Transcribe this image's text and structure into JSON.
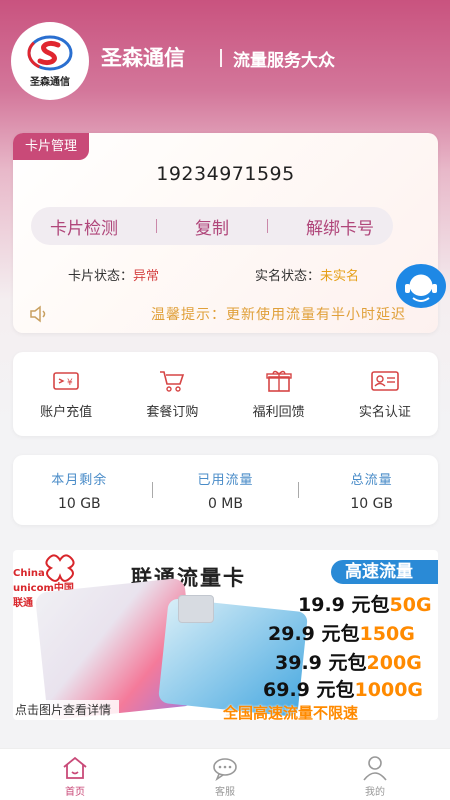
{
  "header": {
    "logo_text": "圣森通信",
    "brand": "圣森通信",
    "slogan": "流量服务大众"
  },
  "card": {
    "tag": "卡片管理",
    "number": "19234971595",
    "actions": [
      "卡片检测",
      "复制",
      "解绑卡号"
    ],
    "card_status_label": "卡片状态：",
    "card_status_value": "异常",
    "realname_label": "实名状态：",
    "realname_value": "未实名",
    "tip": "温馨提示：更新使用流量有半小时延迟"
  },
  "menu": {
    "items": [
      {
        "label": "账户充值",
        "icon": "recharge-icon"
      },
      {
        "label": "套餐订购",
        "icon": "cart-icon"
      },
      {
        "label": "福利回馈",
        "icon": "gift-icon"
      },
      {
        "label": "实名认证",
        "icon": "id-card-icon"
      }
    ]
  },
  "stats": {
    "remaining_label": "本月剩余",
    "remaining_value": "10 GB",
    "used_label": "已用流量",
    "used_value": "0 MB",
    "total_label": "总流量",
    "total_value": "10 GB"
  },
  "banner": {
    "brand_text": "China unicom中国联通",
    "title": "联通流量卡",
    "badge": "高速流量",
    "prices": [
      {
        "price": "19.9",
        "unit": "元包",
        "package": "50G"
      },
      {
        "price": "29.9",
        "unit": "元包",
        "package": "150G"
      },
      {
        "price": "39.9",
        "unit": "元包",
        "package": "200G"
      },
      {
        "price": "69.9",
        "unit": "元包",
        "package": "1000G"
      }
    ],
    "slogan": "全国高速流量不限速",
    "detail": "点击图片查看详情"
  },
  "tabbar": {
    "items": [
      {
        "label": "首页",
        "icon": "home-icon",
        "active": true
      },
      {
        "label": "客服",
        "icon": "chat-icon",
        "active": false
      },
      {
        "label": "我的",
        "icon": "user-icon",
        "active": false
      }
    ]
  },
  "colors": {
    "primary": "#c94a78",
    "accent_blue": "#4a8cc8",
    "warning": "#e6a01a",
    "error": "#d64545"
  }
}
